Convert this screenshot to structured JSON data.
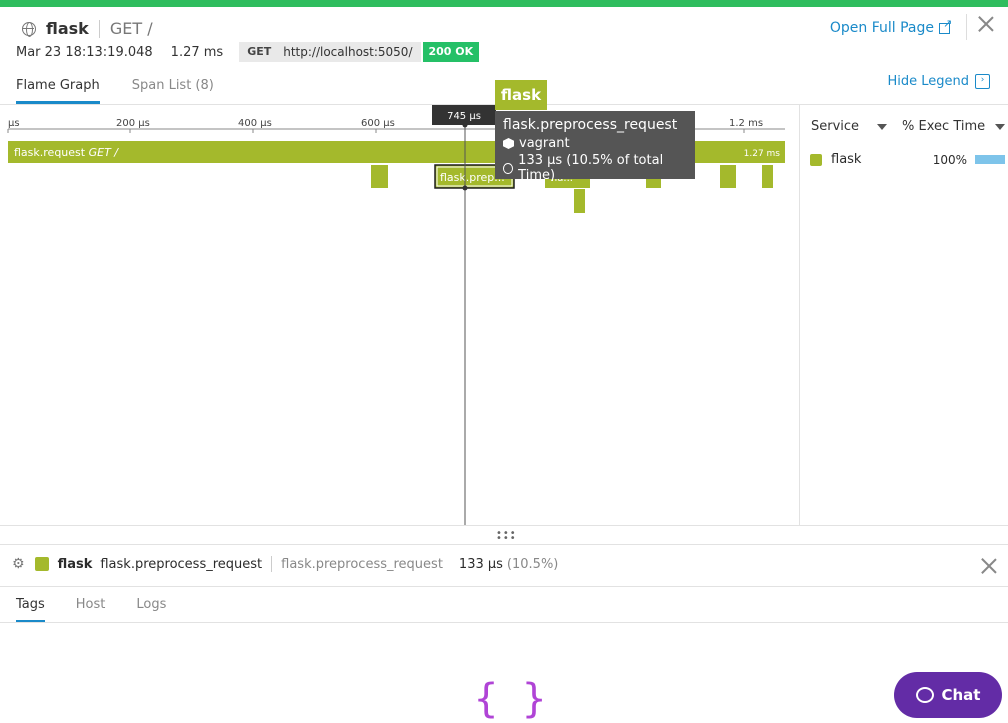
{
  "header": {
    "service": "flask",
    "resource": "GET /",
    "timestamp": "Mar 23 18:13:19.048",
    "duration": "1.27 ms",
    "method": "GET",
    "url": "http://localhost:5050/",
    "status": "200 OK",
    "open_full_page": "Open Full Page"
  },
  "tabs": [
    "Flame Graph",
    "Span List (8)"
  ],
  "hide_legend": "Hide Legend",
  "timeline": {
    "ticks": [
      "µs",
      "200 µs",
      "400 µs",
      "600 µs",
      "1.2 ms"
    ],
    "cursor_label": "745 µs"
  },
  "flame": {
    "root_name": "flask.request",
    "root_resource": "GET /",
    "root_duration": "1.27 ms",
    "selected_label": "flask.prep...",
    "other_label": "fla..."
  },
  "tooltip": {
    "service": "flask",
    "name": "flask.preprocess_request",
    "host": "vagrant",
    "time": "133 µs (10.5% of total Time)"
  },
  "legend": {
    "col_service": "Service",
    "col_exec": "% Exec Time",
    "rows": [
      {
        "service": "flask",
        "pct": "100%"
      }
    ]
  },
  "span": {
    "service": "flask",
    "name": "flask.preprocess_request",
    "resource": "flask.preprocess_request",
    "duration": "133 µs",
    "pct": "(10.5%)",
    "tabs": [
      "Tags",
      "Host",
      "Logs"
    ]
  },
  "chat_label": "Chat",
  "colors": {
    "accent": "#1a8ac9",
    "flask": "#a4b92c",
    "status_ok": "#25c067",
    "chat": "#632ca6"
  }
}
